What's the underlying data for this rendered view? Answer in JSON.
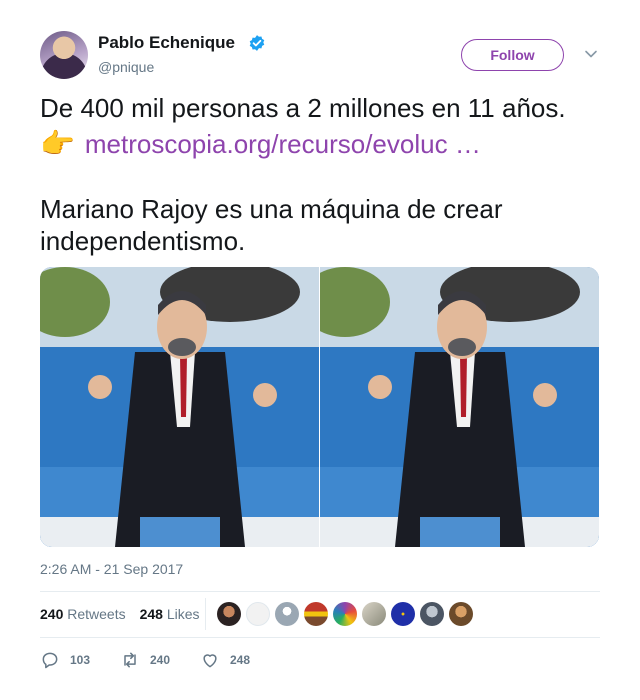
{
  "author": {
    "name": "Pablo Echenique",
    "handle": "@pnique",
    "verified": true
  },
  "follow_label": "Follow",
  "tweet": {
    "line1": "De 400 mil personas a 2 millones en 11 años.",
    "link_text": "metroscopia.org/recurso/evoluc …",
    "line3": "Mariano Rajoy es una máquina de crear",
    "line4": "independentismo."
  },
  "timestamp": "2:26 AM - 21 Sep 2017",
  "stats": {
    "retweets_count": "240",
    "retweets_label": "Retweets",
    "likes_count": "248",
    "likes_label": "Likes"
  },
  "actions": {
    "replies": "103",
    "retweets": "240",
    "likes": "248"
  },
  "colors": {
    "accent": "#8e44ad",
    "verified": "#1da1f2",
    "muted": "#657786"
  },
  "icons": [
    "verified-badge-icon",
    "chevron-down-icon",
    "pointing-hand-icon",
    "reply-icon",
    "retweet-icon",
    "heart-icon"
  ]
}
